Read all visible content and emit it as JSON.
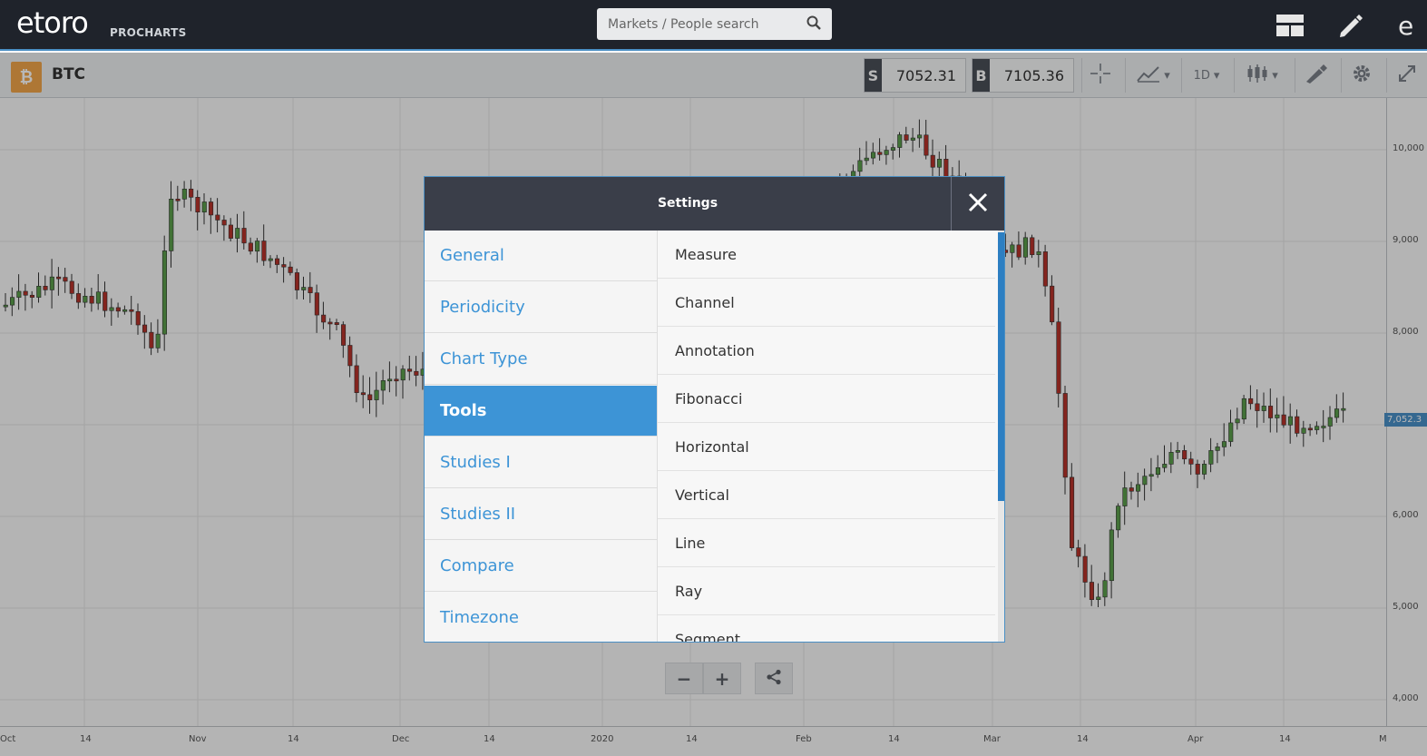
{
  "header": {
    "logo": "etoro",
    "logo_sub": "PROCHARTS",
    "search_placeholder": "Markets / People search"
  },
  "toolbar": {
    "symbol": "BTC",
    "badge": "₿",
    "sell_tag": "S",
    "sell_price": "7052.31",
    "buy_tag": "B",
    "buy_price": "7105.36",
    "periodicity": "1D"
  },
  "chart": {
    "current_price_label": "7,052.3",
    "y_ticks": [
      "10,000",
      "9,000",
      "8,000",
      "6,000",
      "5,000",
      "4,000"
    ],
    "x_ticks": [
      "Oct",
      "14",
      "Nov",
      "14",
      "Dec",
      "14",
      "2020",
      "14",
      "Feb",
      "14",
      "Mar",
      "14",
      "Apr",
      "14",
      "M"
    ]
  },
  "modal": {
    "title": "Settings",
    "tabs": [
      {
        "label": "General"
      },
      {
        "label": "Periodicity"
      },
      {
        "label": "Chart Type"
      },
      {
        "label": "Tools"
      },
      {
        "label": "Studies I"
      },
      {
        "label": "Studies II"
      },
      {
        "label": "Compare"
      },
      {
        "label": "Timezone"
      }
    ],
    "active_tab": "Tools",
    "items": [
      {
        "label": "Measure"
      },
      {
        "label": "Channel"
      },
      {
        "label": "Annotation"
      },
      {
        "label": "Fibonacci"
      },
      {
        "label": "Horizontal"
      },
      {
        "label": "Vertical"
      },
      {
        "label": "Line"
      },
      {
        "label": "Ray"
      },
      {
        "label": "Segment"
      }
    ]
  },
  "colors": {
    "accent": "#3d94d6",
    "header_bg": "#1f232b",
    "candle_up": "#5a9e4b",
    "candle_down": "#b8322a"
  }
}
